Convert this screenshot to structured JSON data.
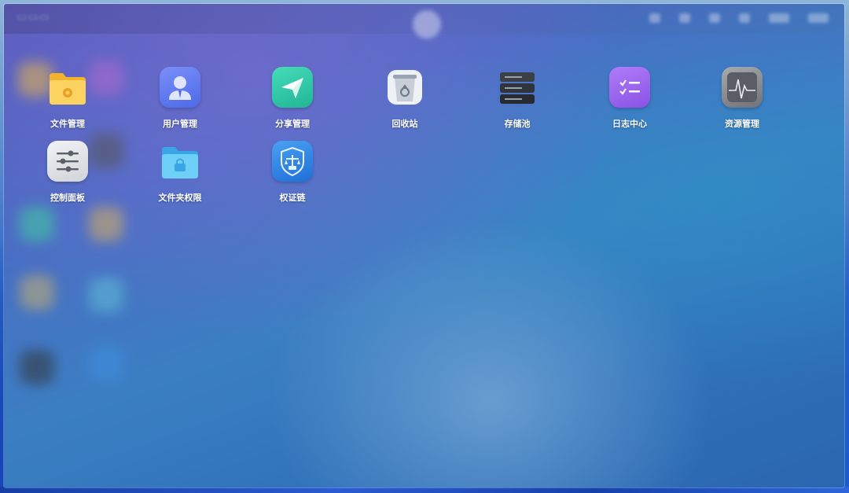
{
  "apps": [
    {
      "label": "文件管理",
      "icon": "folder-settings-icon"
    },
    {
      "label": "用户管理",
      "icon": "user-icon"
    },
    {
      "label": "分享管理",
      "icon": "share-send-icon"
    },
    {
      "label": "回收站",
      "icon": "recycle-bin-icon"
    },
    {
      "label": "存储池",
      "icon": "storage-pool-icon"
    },
    {
      "label": "日志中心",
      "icon": "log-checklist-icon"
    },
    {
      "label": "资源管理",
      "icon": "resource-monitor-icon"
    },
    {
      "label": "控制面板",
      "icon": "control-sliders-icon"
    },
    {
      "label": "文件夹权限",
      "icon": "folder-lock-icon"
    },
    {
      "label": "权证链",
      "icon": "blockchain-shield-icon"
    }
  ],
  "colors": {
    "file_manager": "#f6c23e",
    "user_manager": "#5a7cf0",
    "share_manager": "#2fc7a7",
    "recycle_bin": "#c9d2dc",
    "storage_pool": "#3a3f48",
    "log_center": "#9a63ee",
    "resource_manager": "#8e9198",
    "control_panel": "#e3e6ea",
    "folder_permission": "#5ec0f2",
    "chain": "#2f86e8"
  }
}
